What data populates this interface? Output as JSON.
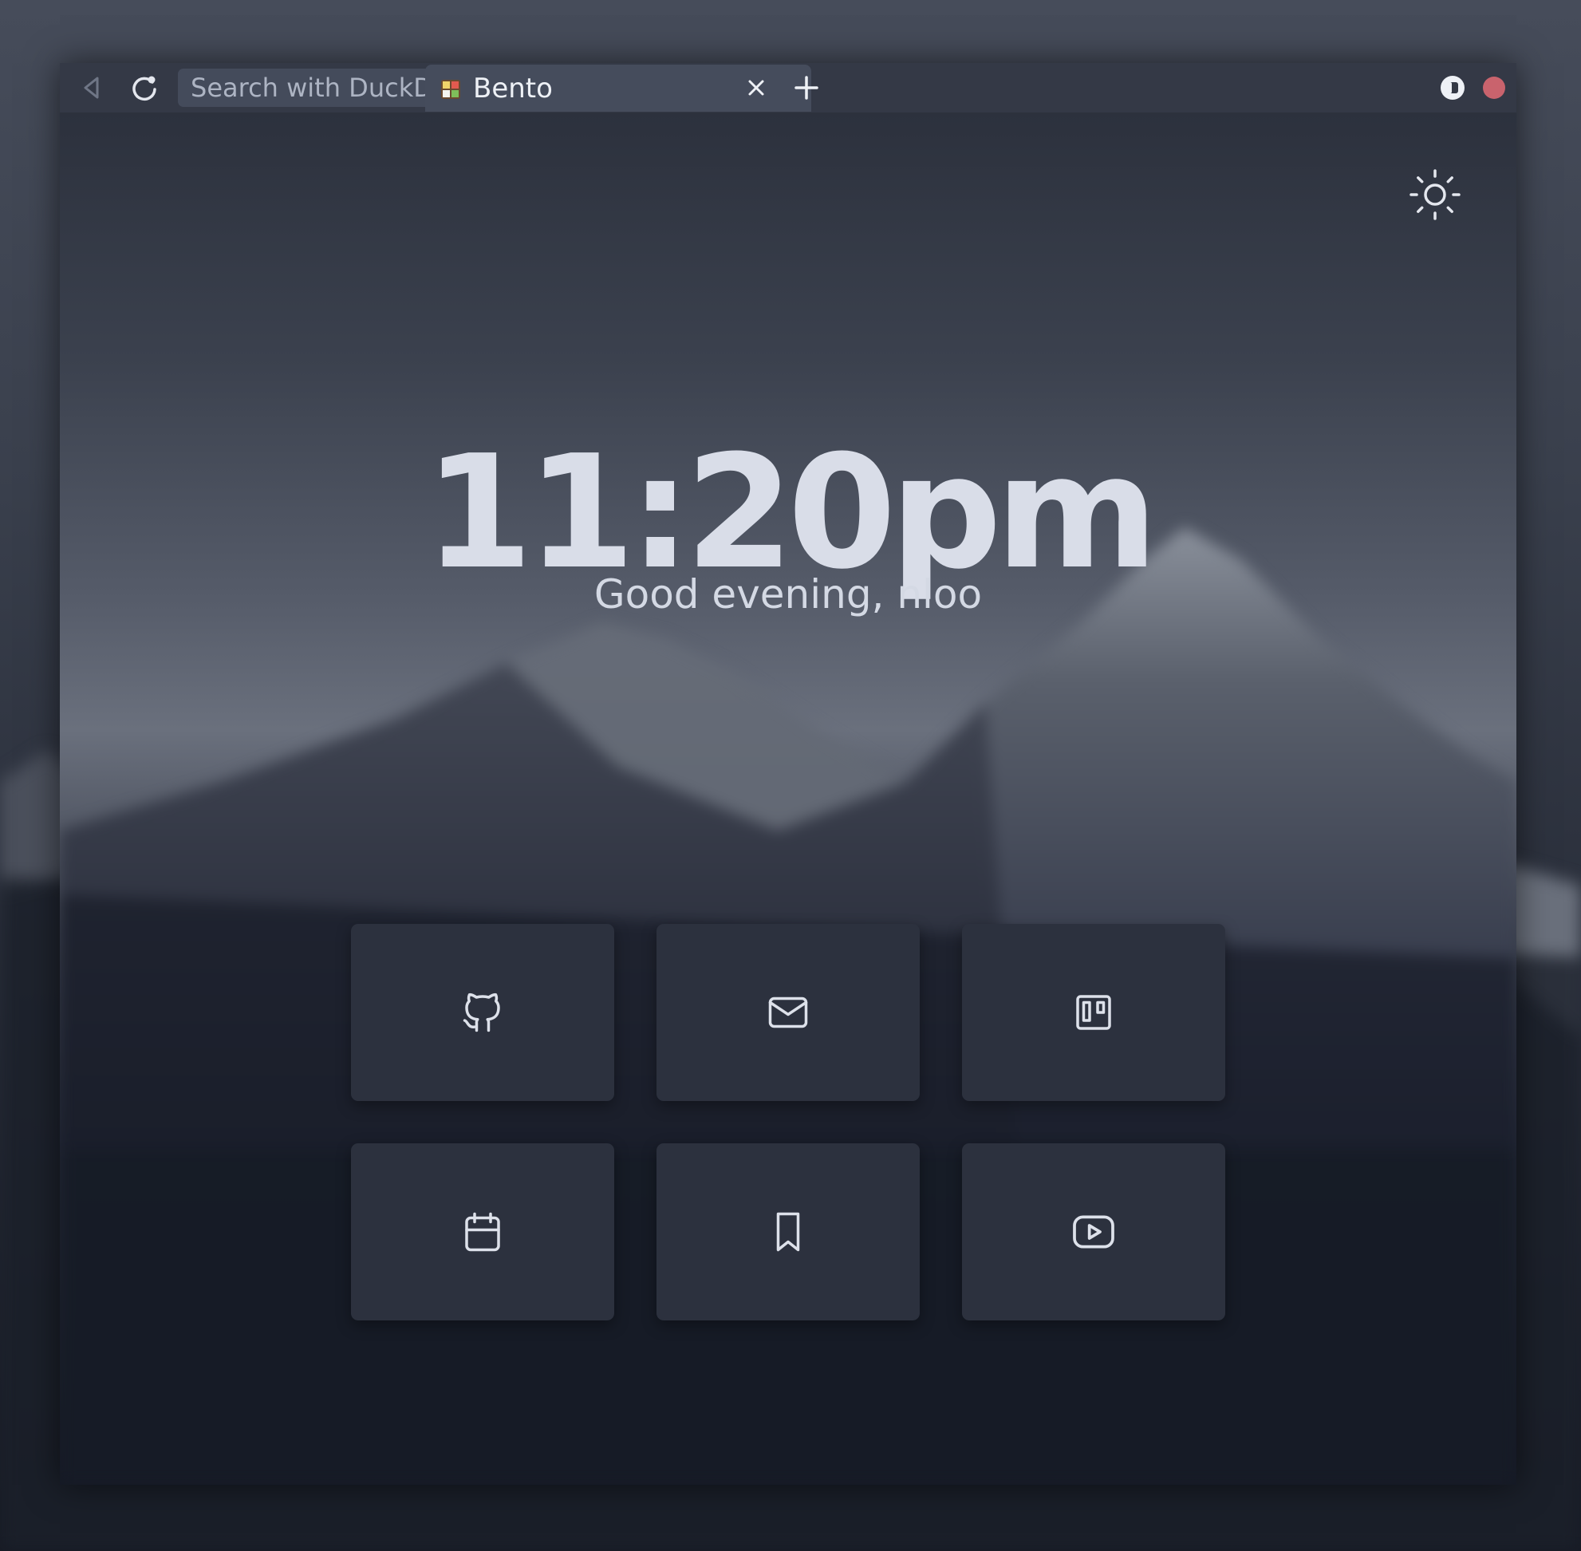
{
  "browser": {
    "url_placeholder": "Search with DuckDuckGo",
    "tab": {
      "title": "Bento",
      "favicon": "bento-box-icon"
    },
    "close_button_color": "#c9636d"
  },
  "page": {
    "clock": "11:20pm",
    "greeting": "Good evening, nloo",
    "theme_toggle_icon": "sun-icon"
  },
  "links": [
    {
      "name": "github",
      "icon": "github-icon"
    },
    {
      "name": "mail",
      "icon": "mail-icon"
    },
    {
      "name": "trello",
      "icon": "trello-icon"
    },
    {
      "name": "calendar",
      "icon": "calendar-icon"
    },
    {
      "name": "bookmark",
      "icon": "bookmark-icon"
    },
    {
      "name": "youtube",
      "icon": "youtube-icon"
    }
  ]
}
